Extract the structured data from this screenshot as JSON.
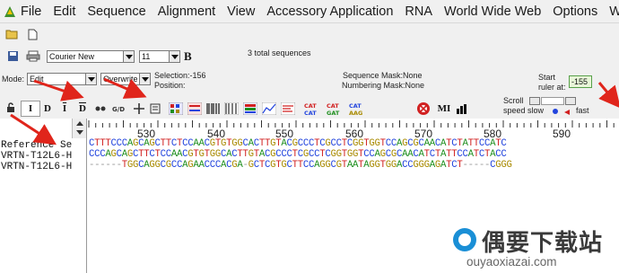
{
  "menu": {
    "items": [
      "File",
      "Edit",
      "Sequence",
      "Alignment",
      "View",
      "Accessory Application",
      "RNA",
      "World Wide Web",
      "Options",
      "Windo"
    ]
  },
  "toolbar": {
    "font_name": "Courier New",
    "font_size": "11",
    "bold_label": "B",
    "total_sequences": "3 total sequences"
  },
  "mode": {
    "label": "Mode:",
    "value": "Edit",
    "overwrite_value": "Overwrite",
    "selection_label": "Selection:-156",
    "position_label": "Position:",
    "sequence_mask": "Sequence Mask:None",
    "numbering_mask": "Numbering Mask:None",
    "start_label": "Start",
    "ruler_at_label": "ruler at:",
    "ruler_start_value": "-155"
  },
  "tools": {
    "scroll_label": "Scroll",
    "speed_slow_label": "speed slow",
    "fast_label": "fast",
    "buttons": [
      "I",
      "D",
      "I",
      "D"
    ]
  },
  "ruler": {
    "ticks": [
      "530",
      "540",
      "550",
      "560",
      "570",
      "580",
      "590"
    ]
  },
  "sequences": [
    {
      "name": "Reference Se",
      "bases": "CTTTCCCAGCAGCTTCTCCAACGTGTGGCACTTGTACGCCCTCGCCTCGGTGGTCCAGCGCAACATCTATTCCATC"
    },
    {
      "name": "VRTN-T12L6-H",
      "bases": "CCCAGCAGCTTCTCCAACGTGTGGCACTTGTACGCCCTCGCCTCGGTGGTCCAGCGCAACATCTATTCCATCTACC"
    },
    {
      "name": "VRTN-T12L6-H",
      "bases": "------TGGCAGGCGCCAGAACCCACGA-GCTCGTGCTTCCAGGCGTAATAGGTGGACCGGGAGATCT-----CGGG"
    }
  ],
  "colors": {
    "A": "#1f8f1f",
    "C": "#2244dd",
    "G": "#a88a00",
    "T": "#d12020",
    "arrow": "#e0251b",
    "ruler_field": "#e8f6d8"
  },
  "watermark": {
    "title": "偶要下载站",
    "url": "ouyaoxiazai.com"
  }
}
